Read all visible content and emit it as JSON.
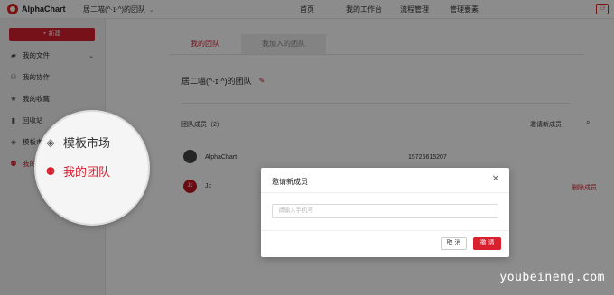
{
  "topbar": {
    "logo_text": "AlphaChart",
    "team_switch": "居二喵(^·ɪ·^)的团队",
    "nav": [
      "首页",
      "我的工作台",
      "流程管理",
      "管理要素"
    ]
  },
  "sidebar": {
    "new_button": "+ 新建",
    "items": [
      {
        "label": "我的文件",
        "icon": "folder-icon"
      },
      {
        "label": "我的协作",
        "icon": "people-icon"
      },
      {
        "label": "我的收藏",
        "icon": "star-icon"
      },
      {
        "label": "回收站",
        "icon": "trash-icon"
      },
      {
        "label": "模板市场",
        "icon": "layers-icon"
      },
      {
        "label": "我的团队",
        "icon": "team-icon"
      }
    ]
  },
  "main": {
    "tabs": [
      "我的团队",
      "我加入的团队"
    ],
    "team_name": "居二喵(^·ɪ·^)的团队",
    "members_header": "团队成员（2）",
    "invite_link": "邀请新成员",
    "members": [
      {
        "name": "AlphaChart",
        "phone": "15726615207",
        "avatar": ""
      },
      {
        "name": "Jc",
        "avatar": "Jc",
        "action": "删除成员"
      }
    ]
  },
  "magnifier": {
    "items": [
      "模板市场",
      "我的团队"
    ]
  },
  "modal": {
    "title": "邀请新成员",
    "input_placeholder": "请输入手机号",
    "cancel": "取 消",
    "confirm": "邀 请"
  },
  "watermark": "youbeineng.com"
}
